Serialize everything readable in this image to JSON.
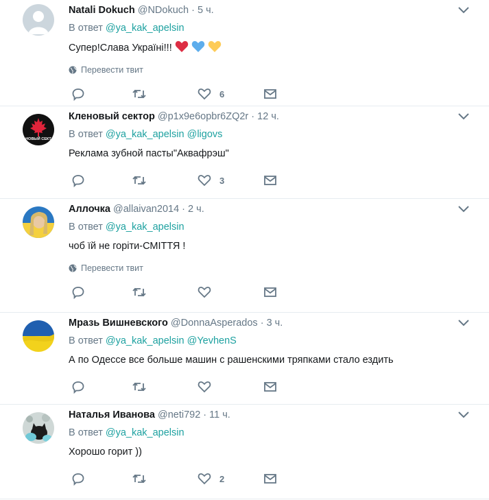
{
  "translate_label": "Перевести твит",
  "tweets": [
    {
      "name": "Natali Dokuch",
      "handle": "@NDokuch",
      "time": "5 ч.",
      "reply_prefix": "В ответ",
      "reply_to": [
        "@ya_kak_apelsin"
      ],
      "text": "Супер!Слава Україні!!!",
      "emoji": [
        "red-heart",
        "blue-heart",
        "yellow-heart"
      ],
      "has_translate": true,
      "likes": "6"
    },
    {
      "name": "Кленовый сектор",
      "handle": "@p1x9e6opbr6ZQ2r",
      "time": "12 ч.",
      "reply_prefix": "В ответ",
      "reply_to": [
        "@ya_kak_apelsin",
        "@ligovs"
      ],
      "text": "Реклама зубной пасты\"Аквафрэш\"",
      "has_translate": false,
      "likes": "3",
      "avatar_text": "НОВЫЙ СЕКТ"
    },
    {
      "name": "Аллочка",
      "handle": "@allaivan2014",
      "time": "2 ч.",
      "reply_prefix": "В ответ",
      "reply_to": [
        "@ya_kak_apelsin"
      ],
      "text": "чоб їй не горіти-СМІТТЯ !",
      "has_translate": true,
      "likes": ""
    },
    {
      "name": "Мразь Вишневского",
      "handle": "@DonnaAsperados",
      "time": "3 ч.",
      "reply_prefix": "В ответ",
      "reply_to": [
        "@ya_kak_apelsin",
        "@YevhenS"
      ],
      "text": "А по Одессе все больше машин с рашенскими тряпками стало ездить",
      "has_translate": false,
      "likes": ""
    },
    {
      "name": "Наталья Иванова",
      "handle": "@neti792",
      "time": "11 ч.",
      "reply_prefix": "В ответ",
      "reply_to": [
        "@ya_kak_apelsin"
      ],
      "text": "Хорошо горит ))",
      "has_translate": false,
      "likes": "2"
    }
  ],
  "colors": {
    "link": "#1da1a0",
    "muted": "#657786",
    "divider": "#e6ecf0"
  }
}
